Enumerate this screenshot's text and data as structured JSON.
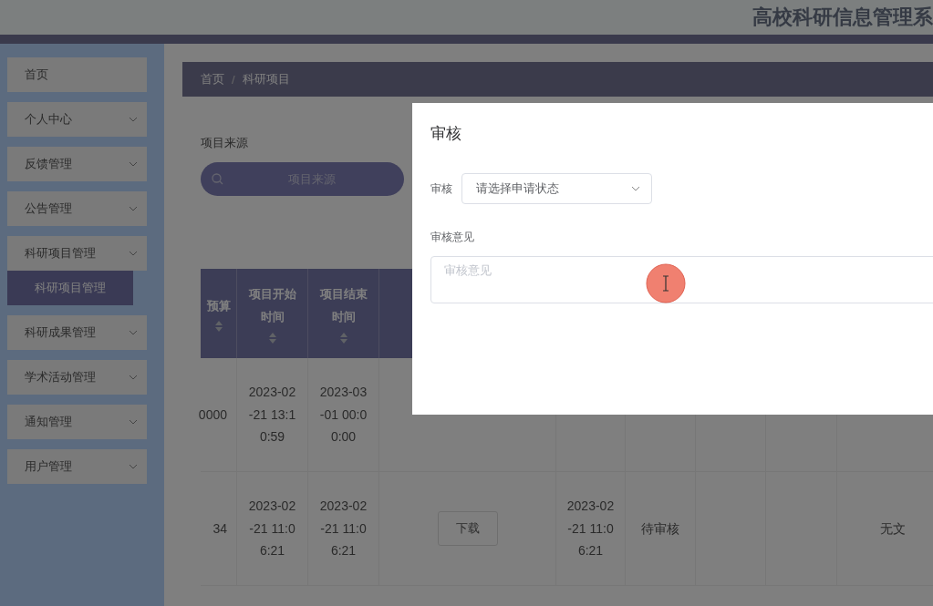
{
  "header": {
    "title": "高校科研信息管理系"
  },
  "sidebar": {
    "items": [
      {
        "label": "首页",
        "expandable": false
      },
      {
        "label": "个人中心",
        "expandable": true
      },
      {
        "label": "反馈管理",
        "expandable": true
      },
      {
        "label": "公告管理",
        "expandable": true
      },
      {
        "label": "科研项目管理",
        "expandable": true,
        "children": [
          {
            "label": "科研项目管理",
            "selected": true
          }
        ]
      },
      {
        "label": "科研成果管理",
        "expandable": true
      },
      {
        "label": "学术活动管理",
        "expandable": true
      },
      {
        "label": "通知管理",
        "expandable": true
      },
      {
        "label": "用户管理",
        "expandable": true
      }
    ]
  },
  "breadcrumb": {
    "separator": "/",
    "items": [
      "首页",
      "科研项目"
    ]
  },
  "search": {
    "label": "项目来源",
    "placeholder": "项目来源"
  },
  "table": {
    "columns": [
      {
        "label": "预算",
        "sortable": true
      },
      {
        "label": "项目开始时间",
        "sortable": true
      },
      {
        "label": "项目结束时间",
        "sortable": true
      },
      {
        "sortable": false
      }
    ],
    "rows": [
      [
        {
          "kind": "text",
          "text": "0000"
        },
        {
          "kind": "text",
          "text": "2023-02-21 13:10:59"
        },
        {
          "kind": "text",
          "text": "2023-03-01 00:00:00"
        },
        {
          "kind": "empty"
        },
        {
          "kind": "empty"
        },
        {
          "kind": "empty"
        },
        {
          "kind": "empty"
        },
        {
          "kind": "empty"
        },
        {
          "kind": "empty"
        }
      ],
      [
        {
          "kind": "text",
          "text": "34"
        },
        {
          "kind": "text",
          "text": "2023-02-21 11:06:21"
        },
        {
          "kind": "text",
          "text": "2023-02-21 11:06:21"
        },
        {
          "kind": "button",
          "text": "下载"
        },
        {
          "kind": "text",
          "text": "2023-02-21 11:06:21"
        },
        {
          "kind": "text",
          "text": "待审核"
        },
        {
          "kind": "empty"
        },
        {
          "kind": "empty"
        },
        {
          "kind": "text",
          "text": "无文"
        }
      ]
    ]
  },
  "dialog": {
    "title": "审核",
    "status_label": "审核",
    "status_placeholder": "请选择申请状态",
    "comment_label": "审核意见",
    "comment_placeholder": "审核意见"
  }
}
